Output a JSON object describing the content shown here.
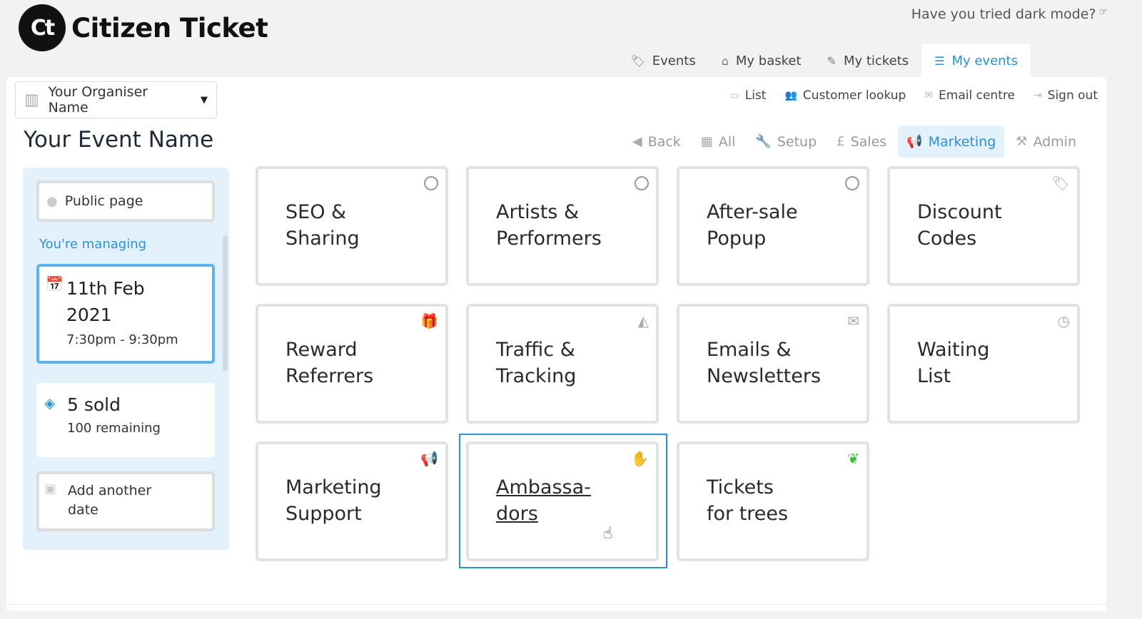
{
  "brand": {
    "mark": "Ct",
    "name": "Citizen Ticket"
  },
  "dark_mode_prompt": "Have you tried dark mode?",
  "top_tabs": [
    {
      "label": "Events",
      "icon": "tags-icon"
    },
    {
      "label": "My basket",
      "icon": "basket-icon"
    },
    {
      "label": "My tickets",
      "icon": "ticket-icon"
    },
    {
      "label": "My events",
      "icon": "sliders-icon",
      "active": true
    }
  ],
  "organiser": {
    "name": "Your Organiser Name"
  },
  "utility_links": [
    {
      "label": "List",
      "icon": "list-icon"
    },
    {
      "label": "Customer lookup",
      "icon": "users-icon"
    },
    {
      "label": "Email centre",
      "icon": "envelope-icon"
    },
    {
      "label": "Sign out",
      "icon": "sign-out-icon"
    }
  ],
  "event": {
    "title": "Your Event Name"
  },
  "section_nav": [
    {
      "label": "Back",
      "icon": "back-arrow-icon"
    },
    {
      "label": "All",
      "icon": "grid-icon"
    },
    {
      "label": "Setup",
      "icon": "wrench-icon"
    },
    {
      "label": "Sales",
      "icon": "pound-icon"
    },
    {
      "label": "Marketing",
      "icon": "megaphone-icon",
      "active": true
    },
    {
      "label": "Admin",
      "icon": "gavel-icon"
    }
  ],
  "sidebar": {
    "public_page": "Public page",
    "managing_label": "You're managing",
    "date_line1": "11th Feb",
    "date_line2": "2021",
    "time": "7:30pm - 9:30pm",
    "sold": "5 sold",
    "remaining": "100 remaining",
    "add_line1": "Add another",
    "add_line2": "date"
  },
  "tiles": [
    {
      "label": "SEO &\nSharing",
      "icon": "circle-icon"
    },
    {
      "label": "Artists &\nPerformers",
      "icon": "circle-icon"
    },
    {
      "label": "After-sale\nPopup",
      "icon": "circle-icon"
    },
    {
      "label": "Discount\nCodes",
      "icon": "tags-icon"
    },
    {
      "label": "Reward\nReferrers",
      "icon": "gift-icon"
    },
    {
      "label": "Traffic &\nTracking",
      "icon": "area-chart-icon"
    },
    {
      "label": "Emails &\nNewsletters",
      "icon": "envelope-icon"
    },
    {
      "label": "Waiting\nList",
      "icon": "clock-icon"
    },
    {
      "label": "Marketing\nSupport",
      "icon": "megaphone-icon"
    },
    {
      "label": "Ambassa-\ndors",
      "icon": "hand-icon",
      "hover": true
    },
    {
      "label": "Tickets\nfor trees",
      "icon": "leaf-icon",
      "color": "#3cbf3c"
    }
  ]
}
